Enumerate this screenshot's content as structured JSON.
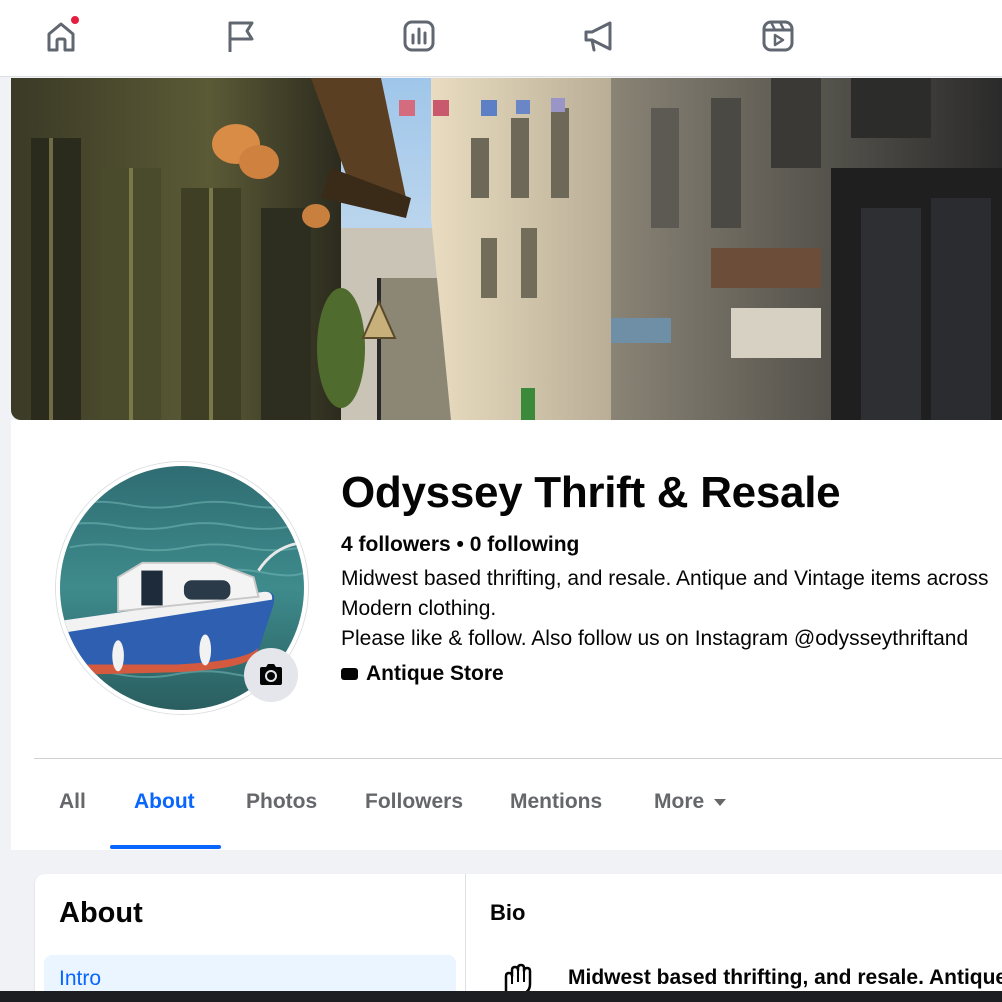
{
  "nav": {
    "items": [
      {
        "name": "home",
        "icon": "home-icon",
        "has_notification": true
      },
      {
        "name": "pages",
        "icon": "flag-icon",
        "has_notification": false
      },
      {
        "name": "insights",
        "icon": "bar-chart-icon",
        "has_notification": false
      },
      {
        "name": "ads",
        "icon": "megaphone-icon",
        "has_notification": false
      },
      {
        "name": "reels",
        "icon": "reels-icon",
        "has_notification": false
      }
    ]
  },
  "profile": {
    "name": "Odyssey Thrift & Resale",
    "followers": "4 followers",
    "separator": " • ",
    "following": "0 following",
    "bio_lines": [
      "Midwest based thrifting, and resale. Antique and Vintage items across",
      "Modern clothing.",
      "Please like & follow. Also follow us on Instagram @odysseythriftand"
    ],
    "category": "Antique Store"
  },
  "tabs": [
    {
      "label": "All",
      "active": false
    },
    {
      "label": "About",
      "active": true
    },
    {
      "label": "Photos",
      "active": false
    },
    {
      "label": "Followers",
      "active": false
    },
    {
      "label": "Mentions",
      "active": false
    },
    {
      "label": "More",
      "active": false
    }
  ],
  "about": {
    "title": "About",
    "intro_label": "Intro",
    "bio_title": "Bio",
    "bio_text": "Midwest based thrifting, and resale. Antique"
  },
  "colors": {
    "accent": "#0866ff",
    "notification": "#e41e3f",
    "secondary_text": "#65676b"
  }
}
